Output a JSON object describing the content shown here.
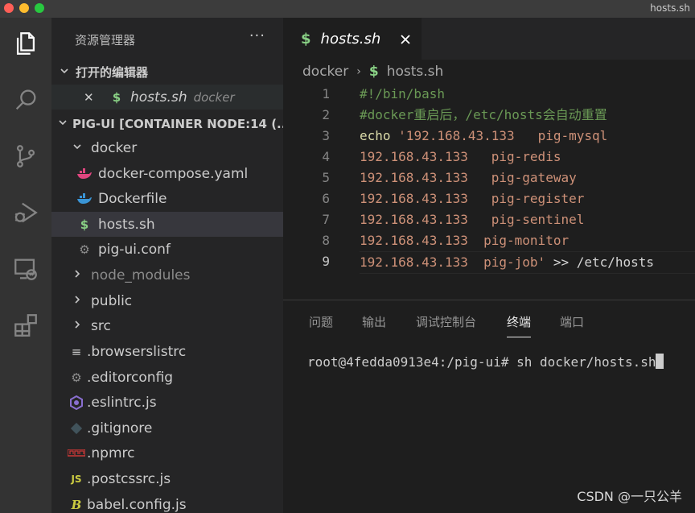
{
  "window": {
    "title": "hosts.sh"
  },
  "activity_bar": {
    "items": [
      {
        "icon": "files-icon",
        "active": true
      },
      {
        "icon": "search-icon",
        "active": false
      },
      {
        "icon": "source-control-icon",
        "active": false
      },
      {
        "icon": "run-debug-icon",
        "active": false
      },
      {
        "icon": "remote-explorer-icon",
        "active": false
      },
      {
        "icon": "extensions-icon",
        "active": false
      }
    ]
  },
  "sidebar": {
    "title": "资源管理器",
    "more": "···",
    "open_editors": {
      "label": "打开的编辑器",
      "items": [
        {
          "name": "hosts.sh",
          "folder": "docker"
        }
      ]
    },
    "workspace": {
      "label": "PIG-UI [CONTAINER NODE:14 (...",
      "tree": [
        {
          "name": "docker",
          "type": "folder",
          "expanded": true
        },
        {
          "name": "docker-compose.yaml",
          "type": "docker-file-icon"
        },
        {
          "name": "Dockerfile",
          "type": "docker-file-icon"
        },
        {
          "name": "hosts.sh",
          "type": "shell-icon"
        },
        {
          "name": "pig-ui.conf",
          "type": "gear-icon"
        },
        {
          "name": "node_modules",
          "type": "folder",
          "expanded": false
        },
        {
          "name": "public",
          "type": "folder",
          "expanded": false
        },
        {
          "name": "src",
          "type": "folder",
          "expanded": false
        },
        {
          "name": ".browserslistrc",
          "type": "list-icon"
        },
        {
          "name": ".editorconfig",
          "type": "gear-icon"
        },
        {
          "name": ".eslintrc.js",
          "type": "eslint-icon"
        },
        {
          "name": ".gitignore",
          "type": "git-icon"
        },
        {
          "name": ".npmrc",
          "type": "npm-icon"
        },
        {
          "name": ".postcssrc.js",
          "type": "js-icon"
        },
        {
          "name": "babel.config.js",
          "type": "babel-icon"
        }
      ]
    }
  },
  "editor": {
    "tab": {
      "label": "hosts.sh",
      "dollar": "$"
    },
    "breadcrumb": {
      "folder": "docker",
      "file": "hosts.sh",
      "dollar": "$"
    },
    "lines": [
      {
        "n": "1",
        "parts": [
          {
            "t": "#!/bin/bash",
            "c": "comment"
          }
        ]
      },
      {
        "n": "2",
        "parts": [
          {
            "t": "#docker重启后，/etc/hosts会自动重置",
            "c": "comment"
          }
        ]
      },
      {
        "n": "3",
        "parts": [
          {
            "t": "echo ",
            "c": "cmd"
          },
          {
            "t": "'192.168.43.133   pig-mysql",
            "c": "string"
          }
        ]
      },
      {
        "n": "4",
        "parts": [
          {
            "t": "192.168.43.133   pig-redis",
            "c": "string"
          }
        ]
      },
      {
        "n": "5",
        "parts": [
          {
            "t": "192.168.43.133   pig-gateway",
            "c": "string"
          }
        ]
      },
      {
        "n": "6",
        "parts": [
          {
            "t": "192.168.43.133   pig-register",
            "c": "string"
          }
        ]
      },
      {
        "n": "7",
        "parts": [
          {
            "t": "192.168.43.133   pig-sentinel",
            "c": "string"
          }
        ]
      },
      {
        "n": "8",
        "parts": [
          {
            "t": "192.168.43.133  pig-monitor",
            "c": "string"
          }
        ]
      },
      {
        "n": "9",
        "parts": [
          {
            "t": "192.168.43.133  pig-job'",
            "c": "string"
          },
          {
            "t": " >> /etc/hosts",
            "c": "plain"
          }
        ]
      }
    ]
  },
  "panel": {
    "tabs": [
      {
        "label": "问题",
        "active": false
      },
      {
        "label": "输出",
        "active": false
      },
      {
        "label": "调试控制台",
        "active": false
      },
      {
        "label": "终端",
        "active": true
      },
      {
        "label": "端口",
        "active": false
      }
    ],
    "terminal_text": "root@4fedda0913e4:/pig-ui# sh docker/hosts.sh"
  },
  "watermark": "CSDN @一只公羊",
  "colors": {
    "activity_bg": "#333333",
    "sidebar_bg": "#252526",
    "editor_bg": "#1e1e1e",
    "comment": "#6a9955",
    "string": "#ce9178",
    "shell_dollar": "#89d185"
  }
}
